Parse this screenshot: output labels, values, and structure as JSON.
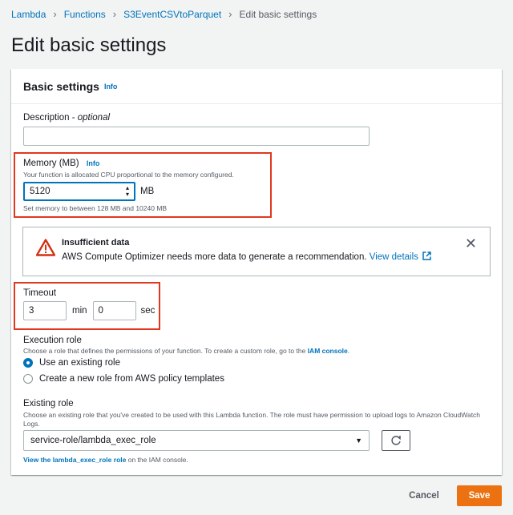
{
  "breadcrumb": {
    "items": [
      "Lambda",
      "Functions",
      "S3EventCSVtoParquet"
    ],
    "current": "Edit basic settings"
  },
  "page_title": "Edit basic settings",
  "panel": {
    "title": "Basic settings",
    "info": "Info"
  },
  "description": {
    "label": "Description - ",
    "label_optional": "optional",
    "value": ""
  },
  "memory": {
    "label": "Memory (MB)",
    "info": "Info",
    "help": "Your function is allocated CPU proportional to the memory configured.",
    "value": "5120",
    "unit": "MB",
    "constraint": "Set memory to between 128 MB and 10240 MB"
  },
  "alert": {
    "title": "Insufficient data",
    "body": "AWS Compute Optimizer needs more data to generate a recommendation.",
    "link": "View details"
  },
  "timeout": {
    "label": "Timeout",
    "min_value": "3",
    "min_unit": "min",
    "sec_value": "0",
    "sec_unit": "sec"
  },
  "execution_role": {
    "label": "Execution role",
    "help_prefix": "Choose a role that defines the permissions of your function. To create a custom role, go to the ",
    "help_link": "IAM console",
    "help_suffix": ".",
    "options": [
      "Use an existing role",
      "Create a new role from AWS policy templates"
    ],
    "selected": 0
  },
  "existing_role": {
    "label": "Existing role",
    "help": "Choose an existing role that you've created to be used with this Lambda function. The role must have permission to upload logs to Amazon CloudWatch Logs.",
    "value": "service-role/lambda_exec_role",
    "view_link": "View the lambda_exec_role role",
    "view_suffix": " on the IAM console."
  },
  "actions": {
    "cancel": "Cancel",
    "save": "Save"
  },
  "colors": {
    "link": "#0073bb",
    "primary_button": "#ec7211",
    "highlight": "#e0381f",
    "warning": "#d13212"
  }
}
